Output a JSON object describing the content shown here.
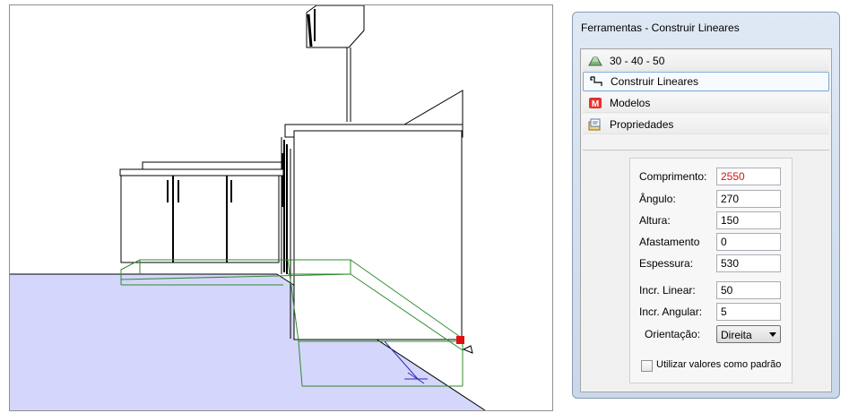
{
  "panel": {
    "title": "Ferramentas - Construir Lineares",
    "tools": [
      {
        "label": "30 - 40 - 50",
        "icon": "roof-icon",
        "selected": false
      },
      {
        "label": "Construir Lineares",
        "icon": "linear-build-icon",
        "selected": true
      },
      {
        "label": "Modelos",
        "icon": "models-m-icon",
        "selected": false
      },
      {
        "label": "Propriedades",
        "icon": "properties-icon",
        "selected": false
      }
    ]
  },
  "form": {
    "comprimento": {
      "label": "Comprimento:",
      "value": "2550"
    },
    "angulo": {
      "label": "Ângulo:",
      "value": "270"
    },
    "altura": {
      "label": "Altura:",
      "value": "150"
    },
    "afastamento": {
      "label": "Afastamento",
      "value": "0"
    },
    "espessura": {
      "label": "Espessura:",
      "value": "530"
    },
    "incr_linear": {
      "label": "Incr. Linear:",
      "value": "50"
    },
    "incr_angular": {
      "label": "Incr. Angular:",
      "value": "5"
    },
    "orientacao": {
      "label": "Orientação:",
      "value": "Direita"
    },
    "checkbox": {
      "label": "Utilizar valores como padrão",
      "checked": false
    }
  },
  "colors": {
    "floor": "#d5d6fb",
    "preview_wireframe": "#2e8b2e",
    "cursor_handle": "#e01010",
    "value_highlight": "#d11515"
  }
}
